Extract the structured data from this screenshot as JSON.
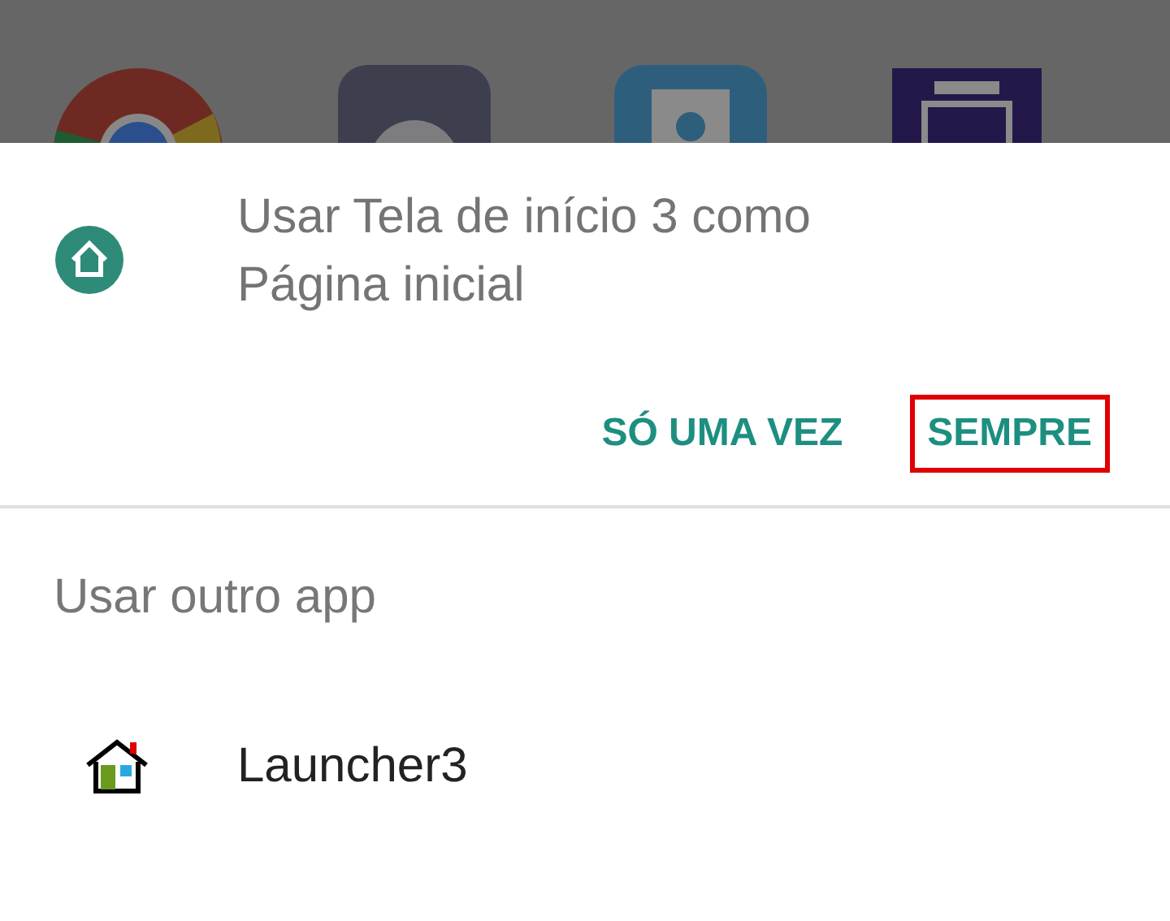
{
  "background_apps": [
    {
      "kind": "ring"
    },
    {
      "kind": "gear"
    },
    {
      "kind": "contact"
    },
    {
      "kind": "chip"
    }
  ],
  "dialog": {
    "title": "Usar Tela de início 3 como Página inicial",
    "buttons": [
      {
        "label": "SÓ UMA VEZ",
        "highlighted": false
      },
      {
        "label": "SEMPRE",
        "highlighted": true
      }
    ],
    "other_heading": "Usar outro app",
    "apps": [
      {
        "name": "Launcher3"
      }
    ]
  }
}
